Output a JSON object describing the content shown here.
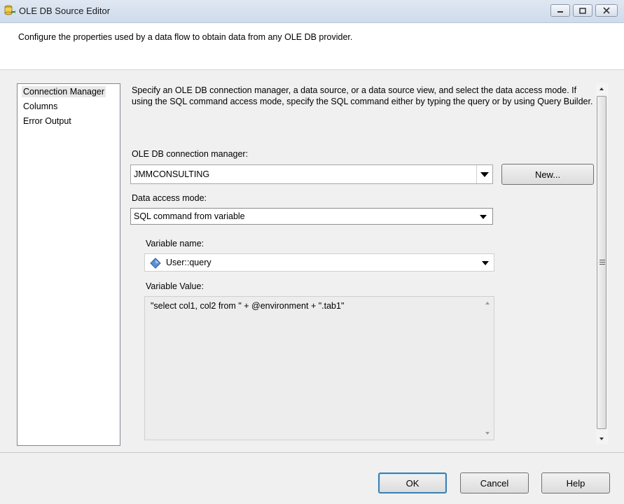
{
  "window": {
    "title": "OLE DB Source Editor",
    "icon": "ssis-source-icon"
  },
  "header": {
    "text": "Configure the properties used by a data flow to obtain data from any OLE DB provider."
  },
  "nav": {
    "items": [
      {
        "label": "Connection Manager",
        "selected": true
      },
      {
        "label": "Columns",
        "selected": false
      },
      {
        "label": "Error Output",
        "selected": false
      }
    ]
  },
  "content": {
    "description": "Specify an OLE DB connection manager, a data source, or a data source view, and select the data access mode. If using the SQL command access mode, specify the SQL command either by typing the query or by using Query Builder.",
    "connection_manager_label": "OLE DB connection manager:",
    "connection_manager_value": "JMMCONSULTING",
    "new_button": "New...",
    "data_access_mode_label": "Data access mode:",
    "data_access_mode_value": "SQL command from variable",
    "variable_name_label": "Variable name:",
    "variable_name_value": "User::query",
    "variable_value_label": "Variable Value:",
    "variable_value_text": "\"select col1, col2 from \" + @environment + \".tab1\""
  },
  "footer": {
    "ok": "OK",
    "cancel": "Cancel",
    "help": "Help"
  },
  "colors": {
    "titlebar": "#cfdbeb",
    "default_button_border": "#3c7fb1"
  }
}
